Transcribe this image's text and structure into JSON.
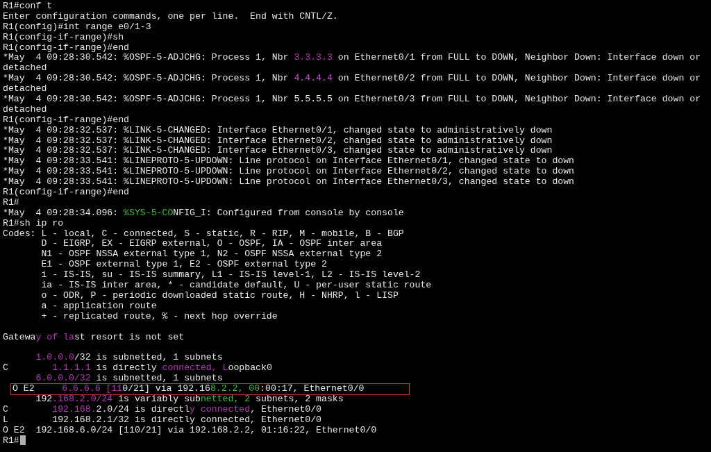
{
  "lines": [
    {
      "text": "R1#conf t",
      "highlighted": false
    },
    {
      "text": "Enter configuration commands, one per line.  End with CNTL/Z.",
      "highlighted": false
    },
    {
      "text": "R1(config)#int range e0/1-3",
      "highlighted": false
    },
    {
      "text": "R1(config-if-range)#sh",
      "highlighted": false
    },
    {
      "text": "R1(config-if-range)#end",
      "highlighted": false
    },
    {
      "segments": [
        {
          "text": "*May  4 09:28:30.542: %OSPF-5-ADJCHG: Process 1, Nbr "
        },
        {
          "text": "3.3.3.3",
          "color": "#b837b8"
        },
        {
          "text": " on Ethernet0/1 from FULL to DOWN, Neighbor Down: Interface down or"
        }
      ],
      "highlighted": false
    },
    {
      "text": "detached",
      "highlighted": false
    },
    {
      "segments": [
        {
          "text": "*May  4 09:28:30.542: %OSPF-5-ADJCHG: Process 1, Nbr "
        },
        {
          "text": "4.4.4.4",
          "color": "#d34ade"
        },
        {
          "text": " on Ethernet0/2 from FULL to DOWN, Neighbor Down: Interface down or"
        }
      ],
      "highlighted": false
    },
    {
      "text": "detached",
      "highlighted": false
    },
    {
      "text": "*May  4 09:28:30.542: %OSPF-5-ADJCHG: Process 1, Nbr 5.5.5.5 on Ethernet0/3 from FULL to DOWN, Neighbor Down: Interface down or",
      "highlighted": false
    },
    {
      "text": "detached",
      "highlighted": false
    },
    {
      "text": "R1(config-if-range)#end",
      "highlighted": false
    },
    {
      "text": "*May  4 09:28:32.537: %LINK-5-CHANGED: Interface Ethernet0/1, changed state to administratively down",
      "highlighted": false
    },
    {
      "text": "*May  4 09:28:32.537: %LINK-5-CHANGED: Interface Ethernet0/2, changed state to administratively down",
      "highlighted": false
    },
    {
      "text": "*May  4 09:28:32.537: %LINK-5-CHANGED: Interface Ethernet0/3, changed state to administratively down",
      "highlighted": false
    },
    {
      "text": "*May  4 09:28:33.541: %LINEPROTO-5-UPDOWN: Line protocol on Interface Ethernet0/1, changed state to down",
      "highlighted": false
    },
    {
      "text": "*May  4 09:28:33.541: %LINEPROTO-5-UPDOWN: Line protocol on Interface Ethernet0/2, changed state to down",
      "highlighted": false
    },
    {
      "text": "*May  4 09:28:33.541: %LINEPROTO-5-UPDOWN: Line protocol on Interface Ethernet0/3, changed state to down",
      "highlighted": false
    },
    {
      "text": "R1(config-if-range)#end",
      "highlighted": false
    },
    {
      "text": "R1#",
      "highlighted": false
    },
    {
      "segments": [
        {
          "text": "*May  4 09:28:34.096: "
        },
        {
          "text": "%SYS-5-CO",
          "color": "#3cbf3c"
        },
        {
          "text": "NFIG_I: Configured from console by console"
        }
      ],
      "highlighted": false
    },
    {
      "text": "R1#sh ip ro",
      "highlighted": false
    },
    {
      "text": "Codes: L - local, C - connected, S - static, R - RIP, M - mobile, B - BGP",
      "highlighted": false
    },
    {
      "text": "       D - EIGRP, EX - EIGRP external, O - OSPF, IA - OSPF inter area",
      "highlighted": false
    },
    {
      "text": "       N1 - OSPF NSSA external type 1, N2 - OSPF NSSA external type 2",
      "highlighted": false
    },
    {
      "text": "       E1 - OSPF external type 1, E2 - OSPF external type 2",
      "highlighted": false
    },
    {
      "text": "       i - IS-IS, su - IS-IS summary, L1 - IS-IS level-1, L2 - IS-IS level-2",
      "highlighted": false
    },
    {
      "text": "       ia - IS-IS inter area, * - candidate default, U - per-user static route",
      "highlighted": false
    },
    {
      "text": "       o - ODR, P - periodic downloaded static route, H - NHRP, l - LISP",
      "highlighted": false
    },
    {
      "text": "       a - application route",
      "highlighted": false
    },
    {
      "text": "       + - replicated route, % - next hop override",
      "highlighted": false
    },
    {
      "highlighted": false
    },
    {
      "segments": [
        {
          "text": "Gatewa"
        },
        {
          "text": "y of la",
          "color": "#b837b8"
        },
        {
          "text": "st resort is not set"
        }
      ],
      "highlighted": false
    },
    {
      "highlighted": false
    },
    {
      "segments": [
        {
          "text": "      1.0.0.0",
          "color": "#b837b8"
        },
        {
          "text": "/32 is subnetted, 1 subnets"
        }
      ],
      "highlighted": false
    },
    {
      "segments": [
        {
          "text": "C        "
        },
        {
          "text": "1.1.1.1",
          "color": "#b837b8"
        },
        {
          "text": " is directly "
        },
        {
          "text": "connected, L",
          "color": "#b837b8"
        },
        {
          "text": "oopback0"
        }
      ],
      "highlighted": false
    },
    {
      "segments": [
        {
          "text": "      6.0.0.0/32",
          "color": "#b837b8"
        },
        {
          "text": " is subnetted, 1 subnets"
        }
      ],
      "highlighted": false
    },
    {
      "segments": [
        {
          "text": "O E2     "
        },
        {
          "text": "6.6.6.6 [11",
          "color": "#b837b8"
        },
        {
          "text": "0/21] via 192.16"
        },
        {
          "text": "8.2.2, 00",
          "color": "#3cbf3c"
        },
        {
          "text": ":00:17, Ethernet0/0"
        }
      ],
      "highlighted": true
    },
    {
      "segments": [
        {
          "text": "      192"
        },
        {
          "text": ".168.2.0/24",
          "color": "#b837b8"
        },
        {
          "text": " is variably sub"
        },
        {
          "text": "netted, 2",
          "color": "#3cbf3c"
        },
        {
          "text": " subnets, 2 masks"
        }
      ],
      "highlighted": false
    },
    {
      "segments": [
        {
          "text": "C        "
        },
        {
          "text": "192.168.",
          "color": "#b837b8"
        },
        {
          "text": "2.0/24 is directl"
        },
        {
          "text": "y connected",
          "color": "#b837b8"
        },
        {
          "text": ", Ethernet0/0"
        }
      ],
      "highlighted": false
    },
    {
      "text": "L        192.168.2.1/32 is directly connected, Ethernet0/0",
      "highlighted": false
    },
    {
      "text": "O E2  192.168.6.0/24 [110/21] via 192.168.2.2, 01:16:22, Ethernet0/0",
      "highlighted": false
    },
    {
      "text": "R1#",
      "highlighted": false,
      "cursor": true
    }
  ]
}
